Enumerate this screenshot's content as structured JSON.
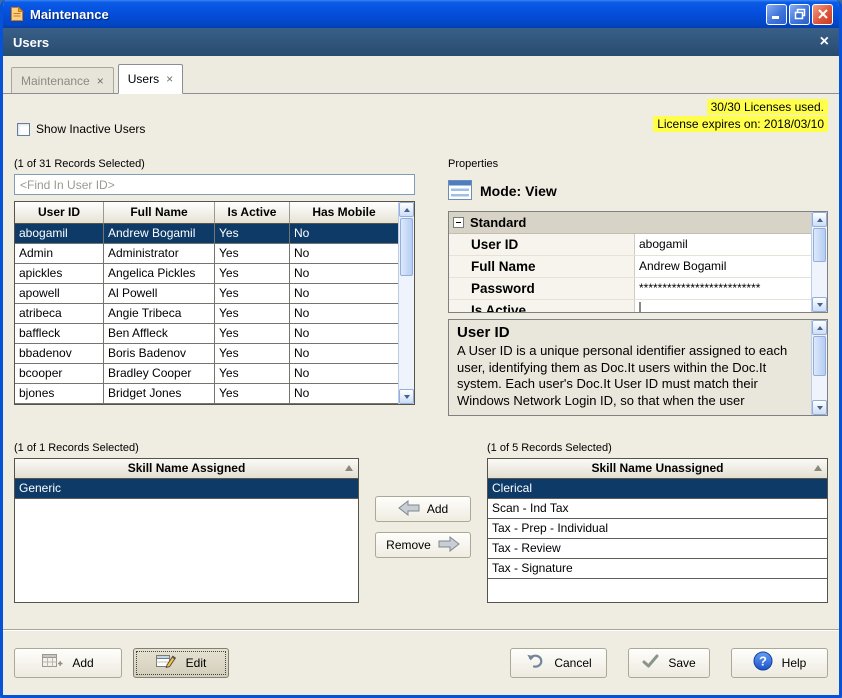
{
  "colors": {
    "titlebar_blue": "#0753D8",
    "subheader_blue": "#284B70",
    "selection_navy": "#0E3A68",
    "highlight_yellow": "#FFFF4B"
  },
  "window": {
    "title": "Maintenance"
  },
  "icons": {
    "close_x": "×",
    "tab_close": "×"
  },
  "subheader": {
    "title": "Users"
  },
  "tabs": [
    {
      "label": "Maintenance"
    },
    {
      "label": "Users"
    }
  ],
  "topbar": {
    "show_inactive_label": "Show Inactive Users",
    "license_line1": "30/30 Licenses used.",
    "license_line2": "License expires on: 2018/03/10"
  },
  "users_panel": {
    "records_label": "(1 of 31 Records Selected)",
    "search_placeholder": "<Find In User ID>",
    "columns": [
      "User ID",
      "Full Name",
      "Is Active",
      "Has Mobile"
    ],
    "rows": [
      [
        "abogamil",
        "Andrew Bogamil",
        "Yes",
        "No"
      ],
      [
        "Admin",
        "Administrator",
        "Yes",
        "No"
      ],
      [
        "apickles",
        "Angelica Pickles",
        "Yes",
        "No"
      ],
      [
        "apowell",
        "Al Powell",
        "Yes",
        "No"
      ],
      [
        "atribeca",
        "Angie Tribeca",
        "Yes",
        "No"
      ],
      [
        "baffleck",
        "Ben Affleck",
        "Yes",
        "No"
      ],
      [
        "bbadenov",
        "Boris Badenov",
        "Yes",
        "No"
      ],
      [
        "bcooper",
        "Bradley Cooper",
        "Yes",
        "No"
      ],
      [
        "bjones",
        "Bridget Jones",
        "Yes",
        "No"
      ]
    ],
    "selected_row": "abogamil"
  },
  "properties_panel": {
    "label": "Properties",
    "mode_label": "Mode: View",
    "group_label": "Standard",
    "fields": [
      {
        "name": "User ID",
        "value": "abogamil"
      },
      {
        "name": "Full Name",
        "value": "Andrew Bogamil"
      },
      {
        "name": "Password",
        "value": "**************************"
      },
      {
        "name": "Is Active",
        "value": ""
      }
    ],
    "description_title": "User ID",
    "description_body": "A User ID is a unique personal identifier assigned to each user, identifying them as Doc.It users within the Doc.It system. Each user's Doc.It User ID must match their Windows Network Login ID, so that when the user"
  },
  "skills": {
    "assigned": {
      "records_label": "(1 of 1 Records Selected)",
      "header": "Skill Name Assigned",
      "rows": [
        "Generic"
      ],
      "selected_row": "Generic"
    },
    "unassigned": {
      "records_label": "(1 of 5 Records Selected)",
      "header": "Skill Name Unassigned",
      "rows": [
        "Clerical",
        "Scan - Ind Tax",
        "Tax - Prep - Individual",
        "Tax - Review",
        "Tax - Signature"
      ],
      "selected_row": "Clerical"
    },
    "add_label": "Add",
    "remove_label": "Remove"
  },
  "footer": {
    "add": "Add",
    "edit": "Edit",
    "cancel": "Cancel",
    "save": "Save",
    "help": "Help"
  }
}
